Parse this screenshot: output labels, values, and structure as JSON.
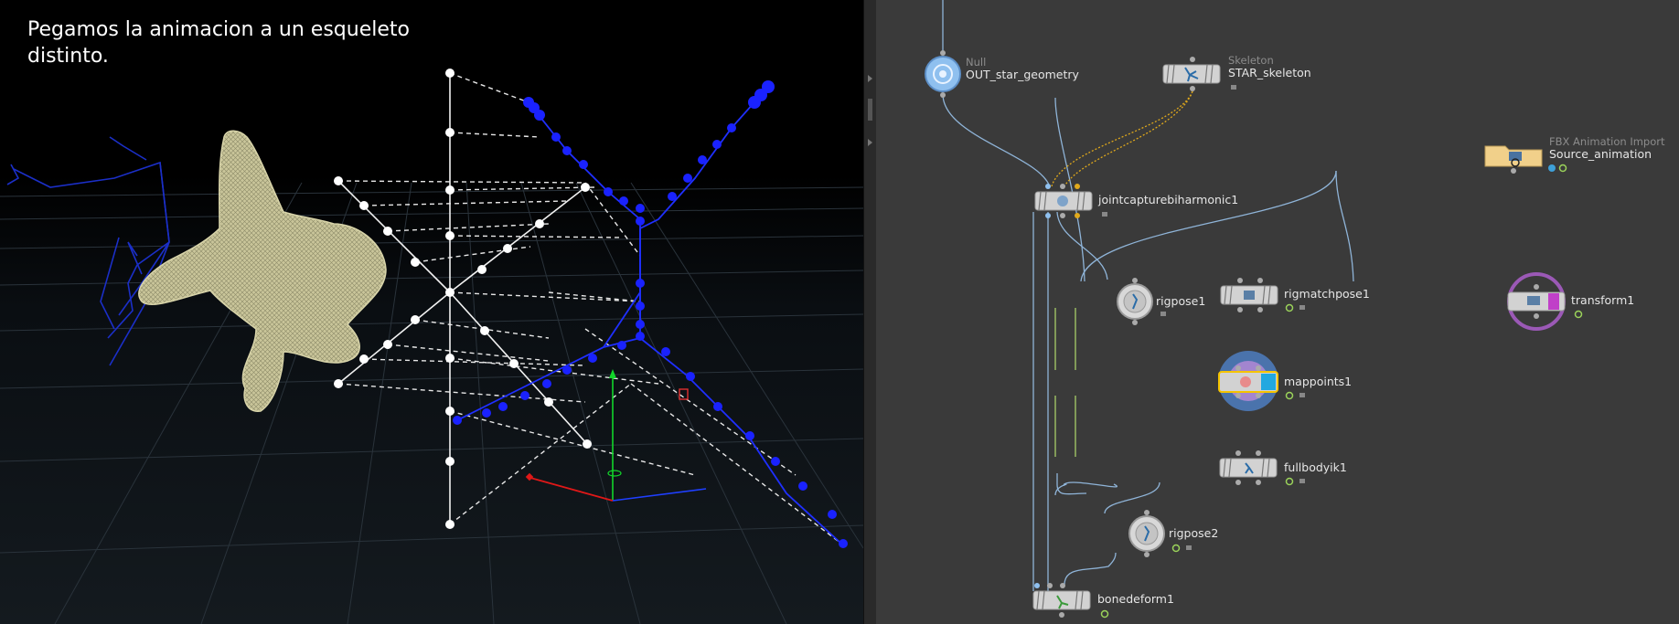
{
  "viewport": {
    "caption": "Pegamos la animacion a un esqueleto distinto."
  },
  "network": {
    "nodes": {
      "out_star_geometry": {
        "type": "Null",
        "name": "OUT_star_geometry"
      },
      "star_skeleton": {
        "type": "Skeleton",
        "name": "STAR_skeleton"
      },
      "source_animation": {
        "type": "FBX Animation Import",
        "name": "Source_animation"
      },
      "jointcapture": {
        "name": "jointcapturebiharmonic1"
      },
      "rigpose1": {
        "name": "rigpose1"
      },
      "rigmatchpose1": {
        "name": "rigmatchpose1"
      },
      "transform1": {
        "name": "transform1"
      },
      "mappoints1": {
        "name": "mappoints1"
      },
      "fullbodyik1": {
        "name": "fullbodyik1"
      },
      "rigpose2": {
        "name": "rigpose2"
      },
      "bonedeform1": {
        "name": "bonedeform1"
      }
    },
    "colors": {
      "background": "#3a3a3a",
      "wire": "#8fb4d8",
      "capture_wire": "#e0a91c",
      "selected_outline": "#f5c400",
      "template_ring": "#9b59b6",
      "display_flag": "#3ea0d8"
    }
  }
}
